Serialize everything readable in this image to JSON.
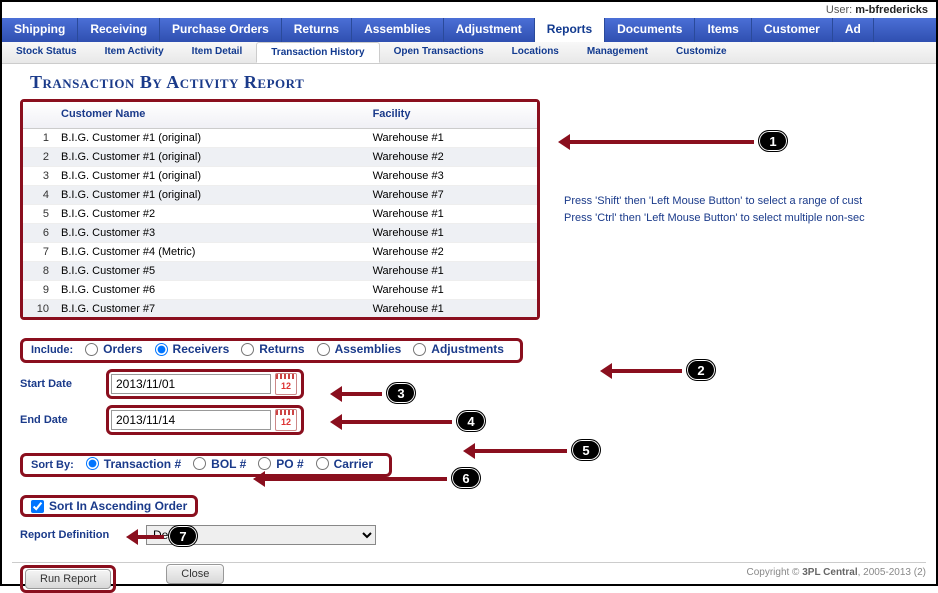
{
  "user": {
    "label": "User:",
    "value": "m-bfredericks"
  },
  "main_nav": {
    "items": [
      "Shipping",
      "Receiving",
      "Purchase Orders",
      "Returns",
      "Assemblies",
      "Adjustment",
      "Reports",
      "Documents",
      "Items",
      "Customer",
      "Ad"
    ],
    "active": "Reports"
  },
  "sub_nav": {
    "items": [
      "Stock Status",
      "Item Activity",
      "Item Detail",
      "Transaction History",
      "Open Transactions",
      "Locations",
      "Management",
      "Customize"
    ],
    "active": "Transaction History"
  },
  "page_title": "Transaction By Activity Report",
  "table": {
    "headers": {
      "num": "",
      "customer": "Customer Name",
      "facility": "Facility"
    },
    "rows": [
      {
        "n": "1",
        "customer": "B.I.G. Customer #1 (original)",
        "facility": "Warehouse #1"
      },
      {
        "n": "2",
        "customer": "B.I.G. Customer #1 (original)",
        "facility": "Warehouse #2"
      },
      {
        "n": "3",
        "customer": "B.I.G. Customer #1 (original)",
        "facility": "Warehouse #3"
      },
      {
        "n": "4",
        "customer": "B.I.G. Customer #1 (original)",
        "facility": "Warehouse #7"
      },
      {
        "n": "5",
        "customer": "B.I.G. Customer #2",
        "facility": "Warehouse #1"
      },
      {
        "n": "6",
        "customer": "B.I.G. Customer #3",
        "facility": "Warehouse #1"
      },
      {
        "n": "7",
        "customer": "B.I.G. Customer #4 (Metric)",
        "facility": "Warehouse #2"
      },
      {
        "n": "8",
        "customer": "B.I.G. Customer #5",
        "facility": "Warehouse #1"
      },
      {
        "n": "9",
        "customer": "B.I.G. Customer #6",
        "facility": "Warehouse #1"
      },
      {
        "n": "10",
        "customer": "B.I.G. Customer #7",
        "facility": "Warehouse #1"
      }
    ]
  },
  "hint": {
    "line1": "Press 'Shift' then 'Left Mouse Button' to select a range of cust",
    "line2": "Press 'Ctrl' then 'Left Mouse Button' to select multiple non-sec"
  },
  "include": {
    "label": "Include:",
    "options": [
      "Orders",
      "Receivers",
      "Returns",
      "Assemblies",
      "Adjustments"
    ],
    "selected": "Receivers"
  },
  "dates": {
    "start_label": "Start Date",
    "start_value": "2013/11/01",
    "end_label": "End Date",
    "end_value": "2013/11/14",
    "cal_num": "12"
  },
  "sortby": {
    "label": "Sort By:",
    "options": [
      "Transaction #",
      "BOL #",
      "PO #",
      "Carrier"
    ],
    "selected": "Transaction #"
  },
  "sort_asc": {
    "label": "Sort In Ascending Order",
    "checked": true
  },
  "report_def": {
    "label": "Report Definition",
    "value": "Default"
  },
  "buttons": {
    "run": "Run Report",
    "close": "Close"
  },
  "footer": {
    "prefix": "Copyright © ",
    "brand": "3PL Central",
    "suffix": ", 2005-2013 (2)"
  },
  "callouts": [
    "1",
    "2",
    "3",
    "4",
    "5",
    "6",
    "7"
  ]
}
